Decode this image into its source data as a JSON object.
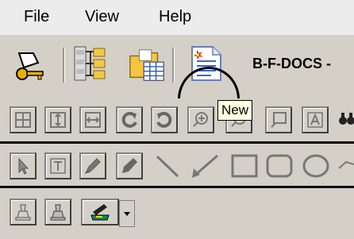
{
  "menu": {
    "items": [
      "File",
      "View",
      "Help"
    ]
  },
  "toolbar1": {
    "title_text": "B-F-DOCS -",
    "tooltip": "New"
  },
  "icons": {
    "row1": [
      "key-icon",
      "database-tree-icon",
      "folder-table-icon",
      "new-document-icon"
    ],
    "row2": [
      "pan-all-icon",
      "pan-vertical-icon",
      "pan-horizontal-icon",
      "rotate-left-icon",
      "rotate-right-icon",
      "zoom-in-icon",
      "zoom-out-icon",
      "callout-icon",
      "text-box-icon",
      "binoculars-icon"
    ],
    "row3": [
      "select-arrow-icon",
      "text-tool-icon",
      "pen-icon",
      "highlighter-icon",
      "line-icon",
      "arrow-line-icon",
      "rectangle-icon",
      "rounded-rectangle-icon",
      "ellipse-icon",
      "polyline-icon"
    ],
    "row4": [
      "stamp-icon",
      "stamp-alt-icon",
      "ink-color-icon",
      "dropdown-arrow-icon"
    ]
  }
}
